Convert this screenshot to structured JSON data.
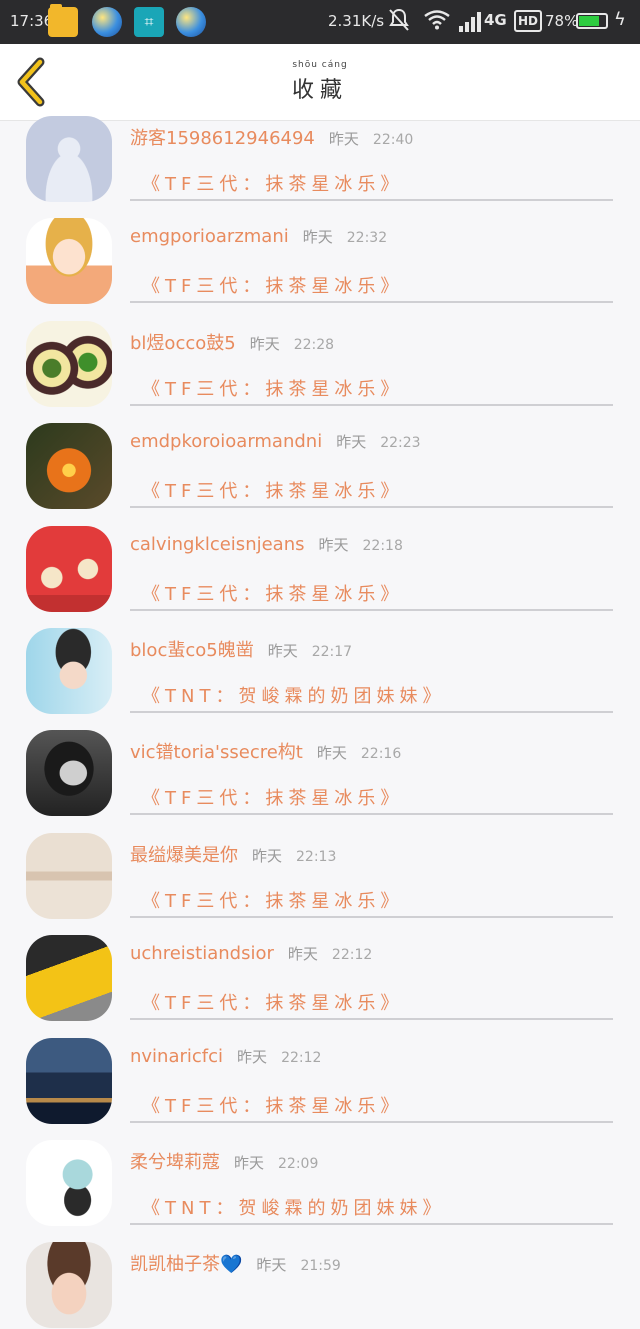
{
  "status_bar": {
    "time": "17:36",
    "net_speed": "2.31K/s",
    "network": "4G",
    "hd": "HD",
    "battery": "78%",
    "battery_level": 0.78
  },
  "header": {
    "title": "收藏",
    "title_pinyin": "shōu cáng"
  },
  "items": [
    {
      "name": "游客1598612946494",
      "date": "昨天",
      "time": "22:40",
      "message": "《TF三代：抹茶星冰乐》",
      "avatar": "default-avatar"
    },
    {
      "name": "emgporioarzmani",
      "date": "昨天",
      "time": "22:32",
      "message": "《TF三代：抹茶星冰乐》",
      "avatar": "anime-boy-avatar"
    },
    {
      "name": "bl煜occo鼓5",
      "date": "昨天",
      "time": "22:28",
      "message": "《TF三代：抹茶星冰乐》",
      "avatar": "drink-cups-avatar"
    },
    {
      "name": "emdpkoroioarmandni",
      "date": "昨天",
      "time": "22:23",
      "message": "《TF三代：抹茶星冰乐》",
      "avatar": "pumpkin-avatar"
    },
    {
      "name": "calvingklceisnjeans",
      "date": "昨天",
      "time": "22:18",
      "message": "《TF三代：抹茶星冰乐》",
      "avatar": "red-envelopes-avatar"
    },
    {
      "name": "bloc蜚co5魄凿",
      "date": "昨天",
      "time": "22:17",
      "message": "《TNT：贺峻霖的奶团妹妹》",
      "avatar": "boy-hat-avatar"
    },
    {
      "name": "vic镨toria'ssecre构t",
      "date": "昨天",
      "time": "22:16",
      "message": "《TF三代：抹茶星冰乐》",
      "avatar": "girl-bw-avatar"
    },
    {
      "name": "最缢爆美是你",
      "date": "昨天",
      "time": "22:13",
      "message": "《TF三代：抹茶星冰乐》",
      "avatar": "text-card-avatar"
    },
    {
      "name": "uchreistiandsior",
      "date": "昨天",
      "time": "22:12",
      "message": "《TF三代：抹茶星冰乐》",
      "avatar": "taxi-avatar"
    },
    {
      "name": "nvinaricfci",
      "date": "昨天",
      "time": "22:12",
      "message": "《TF三代：抹茶星冰乐》",
      "avatar": "city-avatar"
    },
    {
      "name": "柔兮埤莉蔻",
      "date": "昨天",
      "time": "22:09",
      "message": "《TNT：贺峻霖的奶团妹妹》",
      "avatar": "chibi-avatar"
    },
    {
      "name": "凯凯柚子茶💙",
      "date": "昨天",
      "time": "21:59",
      "message": "",
      "avatar": "boy-face-avatar"
    }
  ],
  "colors": {
    "accent": "#e88b5e",
    "back_arrow": "#f2c21b",
    "status_bar": "#2b2b2d"
  }
}
